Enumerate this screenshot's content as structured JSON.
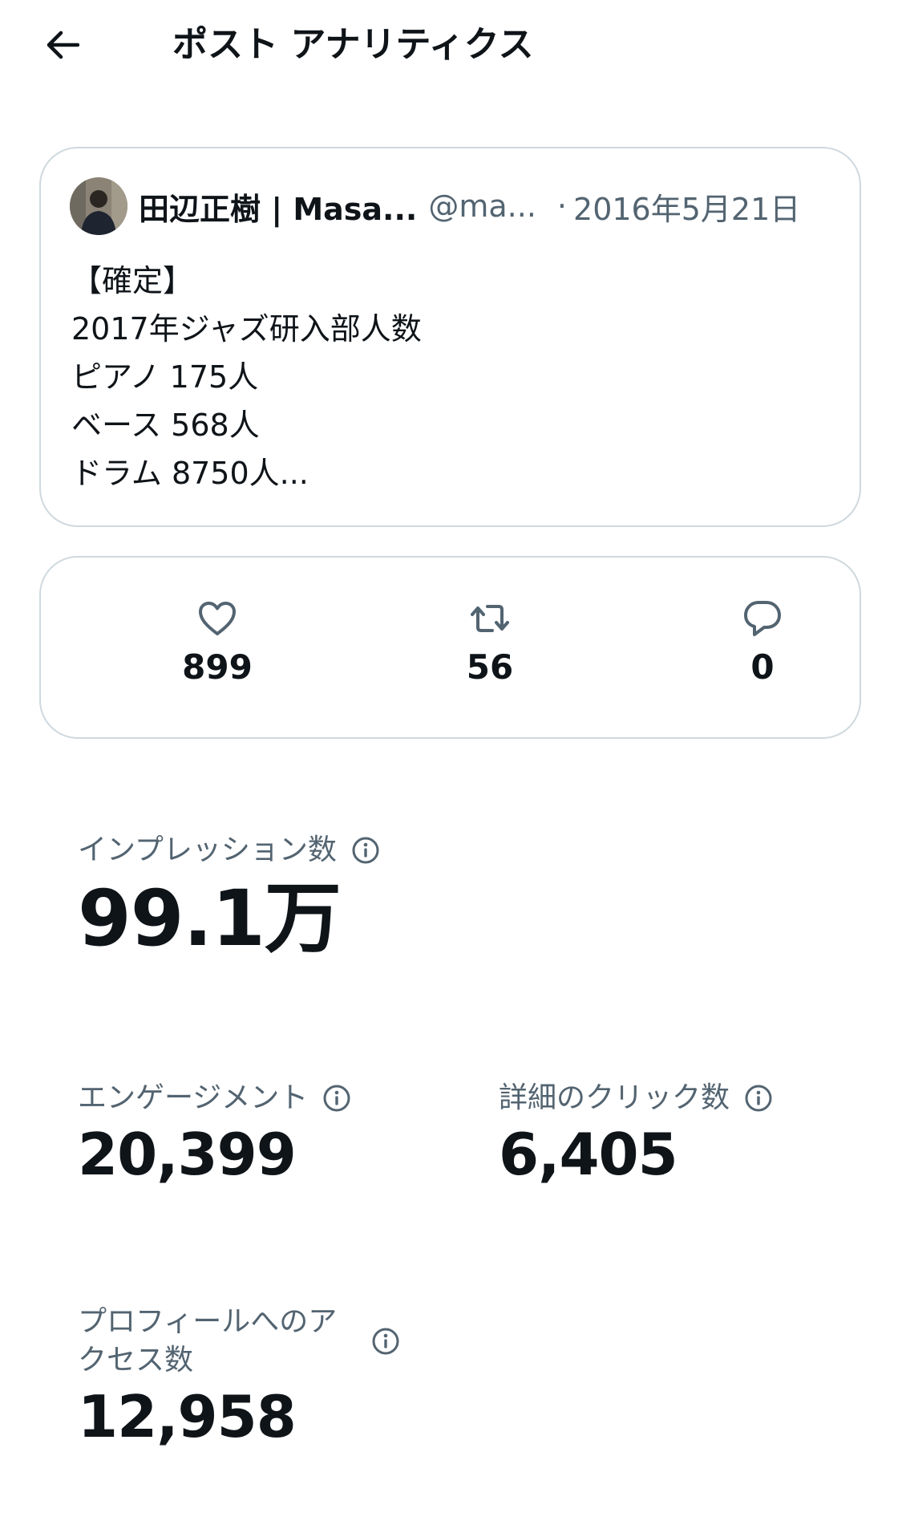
{
  "header": {
    "title": "ポスト アナリティクス",
    "back_icon": "arrow-left-icon"
  },
  "post": {
    "author_name": "田辺正樹 | Masa...",
    "author_handle": "@ma...",
    "separator": "·",
    "date": "2016年5月21日",
    "lines": [
      "【確定】",
      "2017年ジャズ研入部人数",
      "ピアノ 175人",
      "ベース 568人",
      "ドラム 8750人..."
    ]
  },
  "stats": {
    "likes": {
      "icon": "heart-icon",
      "value": "899"
    },
    "reposts": {
      "icon": "repost-icon",
      "value": "56"
    },
    "replies": {
      "icon": "reply-icon",
      "value": "0"
    }
  },
  "metrics": {
    "impressions": {
      "label": "インプレッション数",
      "value": "99.1万"
    },
    "engagements": {
      "label": "エンゲージメント",
      "value": "20,399"
    },
    "detail_clicks": {
      "label": "詳細のクリック数",
      "value": "6,405"
    },
    "profile_visits": {
      "label": "プロフィールへのアクセス数",
      "value": "12,958"
    }
  },
  "colors": {
    "text_primary": "#0f1419",
    "text_secondary": "#536471",
    "border": "#cfd9de",
    "background": "#ffffff"
  }
}
